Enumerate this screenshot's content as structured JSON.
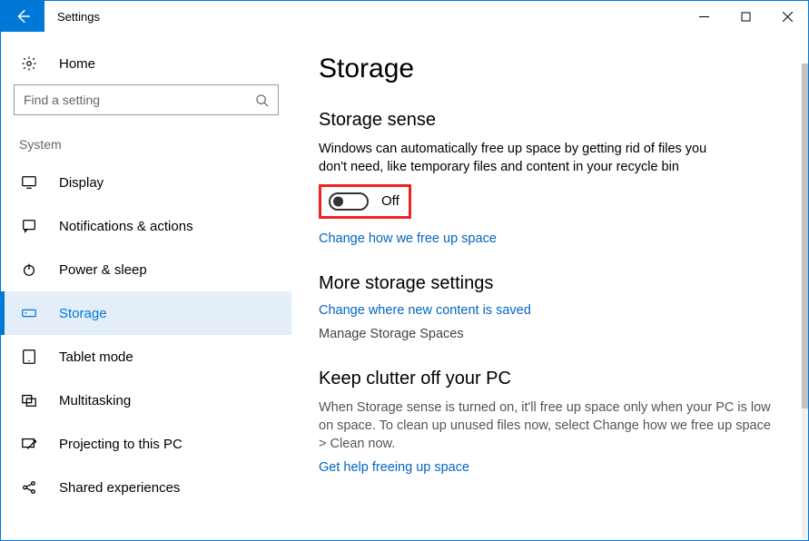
{
  "window": {
    "title": "Settings"
  },
  "sidebar": {
    "home": "Home",
    "search_placeholder": "Find a setting",
    "group": "System",
    "items": [
      {
        "label": "Display"
      },
      {
        "label": "Notifications & actions"
      },
      {
        "label": "Power & sleep"
      },
      {
        "label": "Storage"
      },
      {
        "label": "Tablet mode"
      },
      {
        "label": "Multitasking"
      },
      {
        "label": "Projecting to this PC"
      },
      {
        "label": "Shared experiences"
      }
    ]
  },
  "main": {
    "title": "Storage",
    "sense": {
      "heading": "Storage sense",
      "desc": "Windows can automatically free up space by getting rid of files you don't need, like temporary files and content in your recycle bin",
      "toggle_state": "Off",
      "link": "Change how we free up space"
    },
    "more": {
      "heading": "More storage settings",
      "link1": "Change where new content is saved",
      "link2": "Manage Storage Spaces"
    },
    "clutter": {
      "heading": "Keep clutter off your PC",
      "desc": "When Storage sense is turned on, it'll free up space only when your PC is low on space. To clean up unused files now, select Change how we free up space > Clean now.",
      "link": "Get help freeing up space"
    }
  }
}
